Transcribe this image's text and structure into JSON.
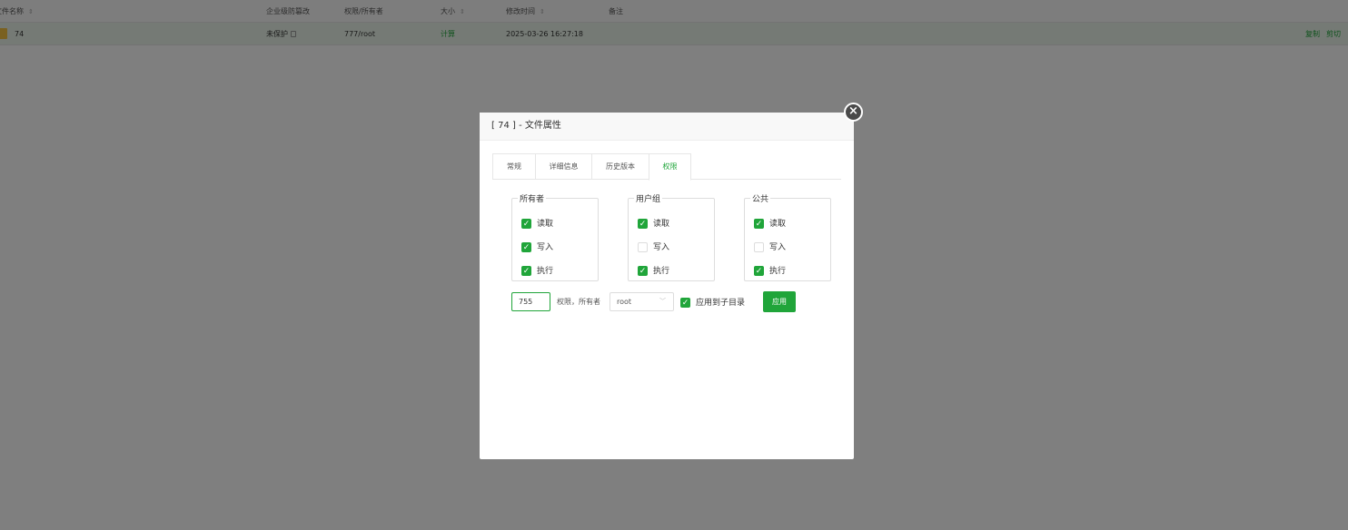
{
  "table": {
    "headers": {
      "name": "文件名称",
      "tamper": "企业级防篡改",
      "perm_owner": "权限/所有者",
      "size": "大小",
      "mtime": "修改时间",
      "note": "备注"
    },
    "row": {
      "name": "74",
      "tamper": "未保护",
      "perm_owner": "777/root",
      "size": "计算",
      "mtime": "2025-03-26 16:27:18",
      "actions": [
        "复制",
        "剪切"
      ]
    }
  },
  "dialog": {
    "title": "[ 74 ] - 文件属性",
    "tabs": [
      "常规",
      "详细信息",
      "历史版本",
      "权限"
    ],
    "active_tab": "权限",
    "groups": [
      {
        "legend": "所有者",
        "read": "读取",
        "write": "写入",
        "exec": "执行",
        "read_checked": true,
        "write_checked": true,
        "exec_checked": true
      },
      {
        "legend": "用户组",
        "read": "读取",
        "write": "写入",
        "exec": "执行",
        "read_checked": true,
        "write_checked": false,
        "exec_checked": true
      },
      {
        "legend": "公共",
        "read": "读取",
        "write": "写入",
        "exec": "执行",
        "read_checked": true,
        "write_checked": false,
        "exec_checked": true
      }
    ],
    "perm_value": "755",
    "perm_owner_label": "权限，所有者",
    "owner_value": "root",
    "apply_subdir_label": "应用到子目录",
    "apply_subdir_checked": true,
    "apply_button": "应用"
  },
  "colors": {
    "accent": "#20a53a",
    "overlay": "rgba(0,0,0,0.5)"
  }
}
